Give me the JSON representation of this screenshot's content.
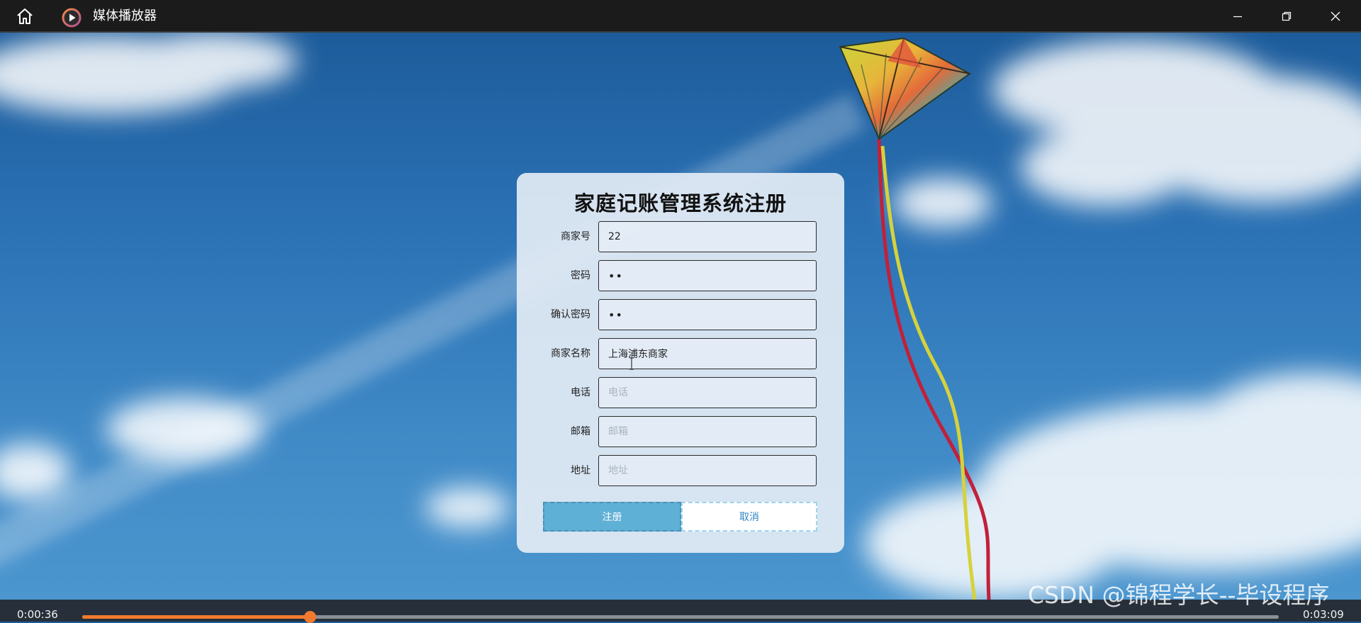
{
  "window": {
    "title": "媒体播放器",
    "home_icon": "home-icon",
    "app_icon": "media-player-icon",
    "buttons": [
      "minimize-icon",
      "restore-icon",
      "close-icon"
    ]
  },
  "form": {
    "title": "家庭记账管理系统注册",
    "fields": [
      {
        "label": "商家号",
        "value": "22",
        "placeholder": "",
        "type": "text"
      },
      {
        "label": "密码",
        "value": "••",
        "placeholder": "",
        "type": "password"
      },
      {
        "label": "确认密码",
        "value": "••",
        "placeholder": "",
        "type": "password"
      },
      {
        "label": "商家名称",
        "value": "上海浦东商家",
        "placeholder": "",
        "type": "text"
      },
      {
        "label": "电话",
        "value": "",
        "placeholder": "电话",
        "type": "text"
      },
      {
        "label": "邮箱",
        "value": "",
        "placeholder": "邮箱",
        "type": "text"
      },
      {
        "label": "地址",
        "value": "",
        "placeholder": "地址",
        "type": "text"
      }
    ],
    "submit_label": "注册",
    "cancel_label": "取消"
  },
  "player": {
    "current_time": "0:00:36",
    "total_time": "0:03:09",
    "progress": 0.19
  },
  "watermark": "CSDN @锦程学长--毕设程序",
  "colors": {
    "accent": "#f27a2e",
    "submit_bg": "#5fb0d6",
    "cancel_text": "#2f86c3",
    "titlebar_bg": "#1b1b1b"
  }
}
